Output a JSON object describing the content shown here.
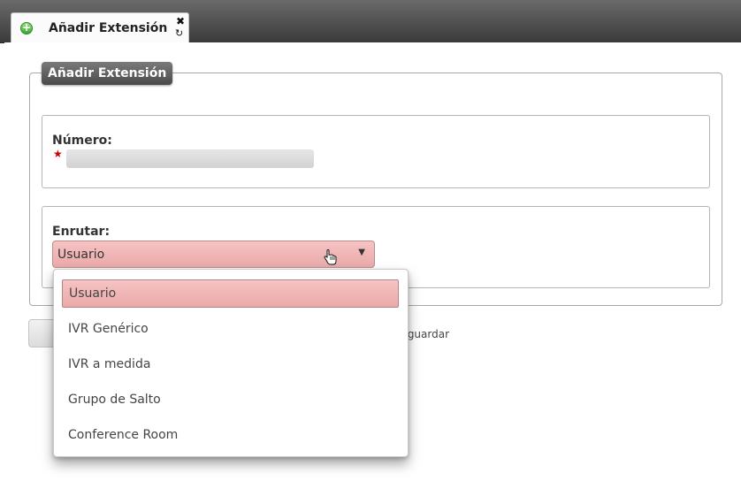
{
  "tab": {
    "title": "Añadir Extensión",
    "close_glyph": "✖",
    "reload_glyph": "↻"
  },
  "form": {
    "legend": "Añadir Extensión",
    "numero": {
      "label": "Número:",
      "value": ""
    },
    "enrutar": {
      "label": "Enrutar:",
      "selected": "Usuario"
    }
  },
  "save_hint": "de guardar",
  "dropdown": {
    "options": [
      "Usuario",
      "IVR Genérico",
      "IVR a medida",
      "Grupo de Salto",
      "Conference Room"
    ],
    "selected_index": 0
  },
  "colors": {
    "select_bg": "#eeb6b6",
    "tabbar": "#4a4a4a",
    "required": "#cc0000"
  }
}
